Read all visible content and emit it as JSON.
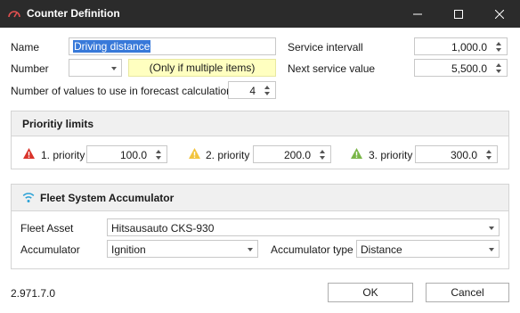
{
  "window": {
    "title": "Counter Definition",
    "icon": "gauge-icon",
    "controls": [
      "minimize-icon",
      "maximize-icon",
      "close-icon"
    ]
  },
  "form": {
    "name_label": "Name",
    "name_value": "Driving distance",
    "number_label": "Number",
    "number_value": "",
    "number_hint": "(Only if multiple items)",
    "forecast_label": "Number of values to use in forecast calculation",
    "forecast_value": "4",
    "service_interval_label": "Service intervall",
    "service_interval_value": "1,000.0",
    "next_service_label": "Next service value",
    "next_service_value": "5,500.0"
  },
  "priority": {
    "title": "Prioritiy limits",
    "items": [
      {
        "label": "1. priority",
        "value": "100.0",
        "color": "#d9342b",
        "icon": "warning-red-icon"
      },
      {
        "label": "2. priority",
        "value": "200.0",
        "color": "#f2c43d",
        "icon": "warning-yellow-icon"
      },
      {
        "label": "3. priority",
        "value": "300.0",
        "color": "#7ab648",
        "icon": "warning-green-icon"
      }
    ]
  },
  "fleet": {
    "title": "Fleet System Accumulator",
    "icon": "wifi-signal-icon",
    "asset_label": "Fleet Asset",
    "asset_value": "Hitsausauto CKS-930",
    "accumulator_label": "Accumulator",
    "accumulator_value": "Ignition",
    "accumulator_type_label": "Accumulator type",
    "accumulator_type_value": "Distance"
  },
  "footer": {
    "version": "2.971.7.0",
    "ok_label": "OK",
    "cancel_label": "Cancel"
  },
  "colors": {
    "titlebar": "#2b2b2b",
    "selection": "#3879d9",
    "hint_background": "#ffffc0",
    "accent_wifi": "#2aa1d6"
  }
}
